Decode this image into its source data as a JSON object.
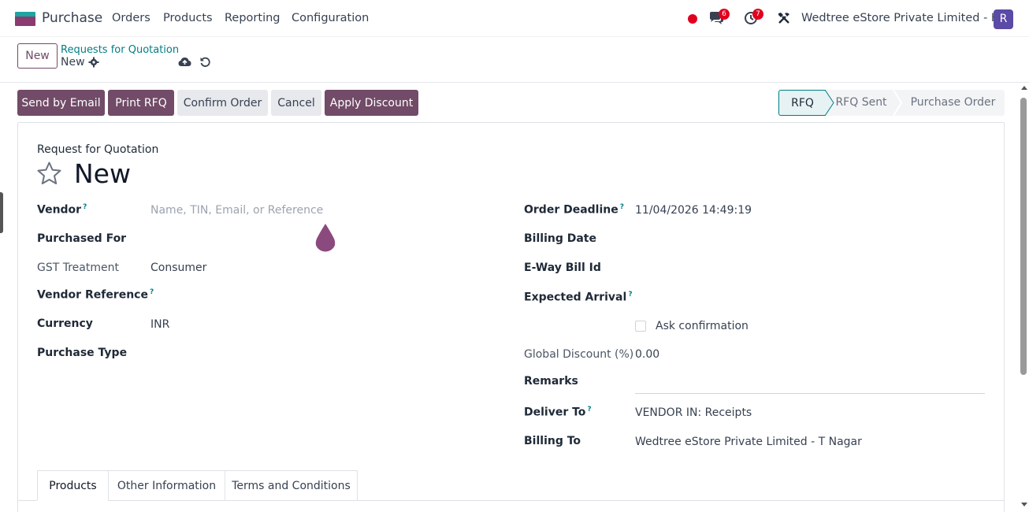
{
  "navbar": {
    "app_name": "Purchase",
    "menu": [
      "Orders",
      "Products",
      "Reporting",
      "Configuration"
    ],
    "chat_count": "6",
    "activity_count": "7",
    "company": "Wedtree eStore Private Limited - HO",
    "avatar_letter": "R"
  },
  "control_panel": {
    "new_label": "New",
    "breadcrumb_parent": "Requests for Quotation",
    "breadcrumb_current": "New"
  },
  "actions": {
    "send_email": "Send by Email",
    "print_rfq": "Print RFQ",
    "confirm_order": "Confirm Order",
    "cancel": "Cancel",
    "apply_discount": "Apply Discount"
  },
  "statusbar": {
    "stages": [
      "RFQ",
      "RFQ Sent",
      "Purchase Order"
    ],
    "active": "RFQ"
  },
  "form": {
    "sheet_label": "Request for Quotation",
    "record_name": "New",
    "left": {
      "vendor_label": "Vendor",
      "vendor_placeholder": "Name, TIN, Email, or Reference",
      "purchased_for_label": "Purchased For",
      "gst_label": "GST Treatment",
      "gst_value": "Consumer",
      "vendor_ref_label": "Vendor Reference",
      "currency_label": "Currency",
      "currency_value": "INR",
      "purchase_type_label": "Purchase Type"
    },
    "right": {
      "order_deadline_label": "Order Deadline",
      "order_deadline_value": "11/04/2026 14:49:19",
      "billing_date_label": "Billing Date",
      "eway_label": "E-Way Bill Id",
      "expected_arrival_label": "Expected Arrival",
      "ask_confirmation_label": "Ask confirmation",
      "global_discount_label": "Global Discount (%)",
      "global_discount_value": "0.00",
      "remarks_label": "Remarks",
      "deliver_to_label": "Deliver To",
      "deliver_to_value": "VENDOR IN: Receipts",
      "billing_to_label": "Billing To",
      "billing_to_value": "Wedtree eStore Private Limited - T Nagar"
    },
    "help_mark": "?"
  },
  "tabs": [
    "Products",
    "Other Information",
    "Terms and Conditions"
  ],
  "colors": {
    "brand": "#714b67",
    "link": "#017e84",
    "badge": "#e1001e"
  }
}
